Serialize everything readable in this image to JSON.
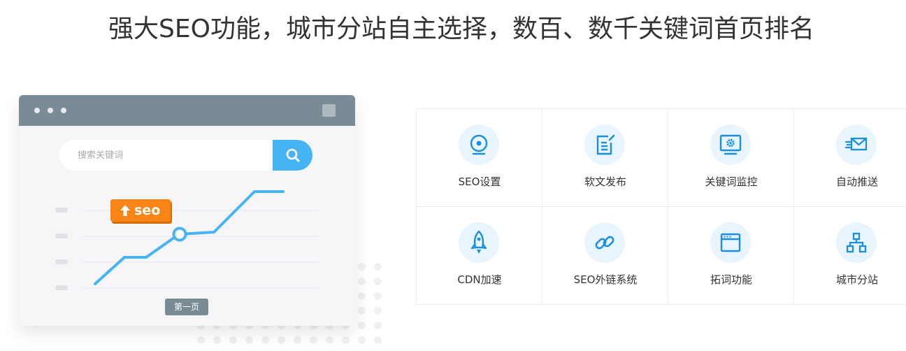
{
  "headline": "强大SEO功能，城市分站自主选择，数百、数千关键词首页排名",
  "illustration": {
    "search_placeholder": "搜索关键词",
    "badge_text": "seo",
    "page_chip": "第一页"
  },
  "features": [
    {
      "label": "SEO设置",
      "icon": "target-icon"
    },
    {
      "label": "软文发布",
      "icon": "document-edit-icon"
    },
    {
      "label": "关键词监控",
      "icon": "monitor-gear-icon"
    },
    {
      "label": "自动推送",
      "icon": "send-mail-icon"
    },
    {
      "label": "CDN加速",
      "icon": "rocket-icon"
    },
    {
      "label": "SEO外链系统",
      "icon": "link-icon"
    },
    {
      "label": "拓词功能",
      "icon": "browser-window-icon"
    },
    {
      "label": "城市分站",
      "icon": "sitemap-icon"
    }
  ],
  "colors": {
    "accent": "#46b4f3",
    "icon_blue": "#1a8ee1",
    "badge_orange": "#fa8517",
    "titlebar": "#7b8b96"
  }
}
